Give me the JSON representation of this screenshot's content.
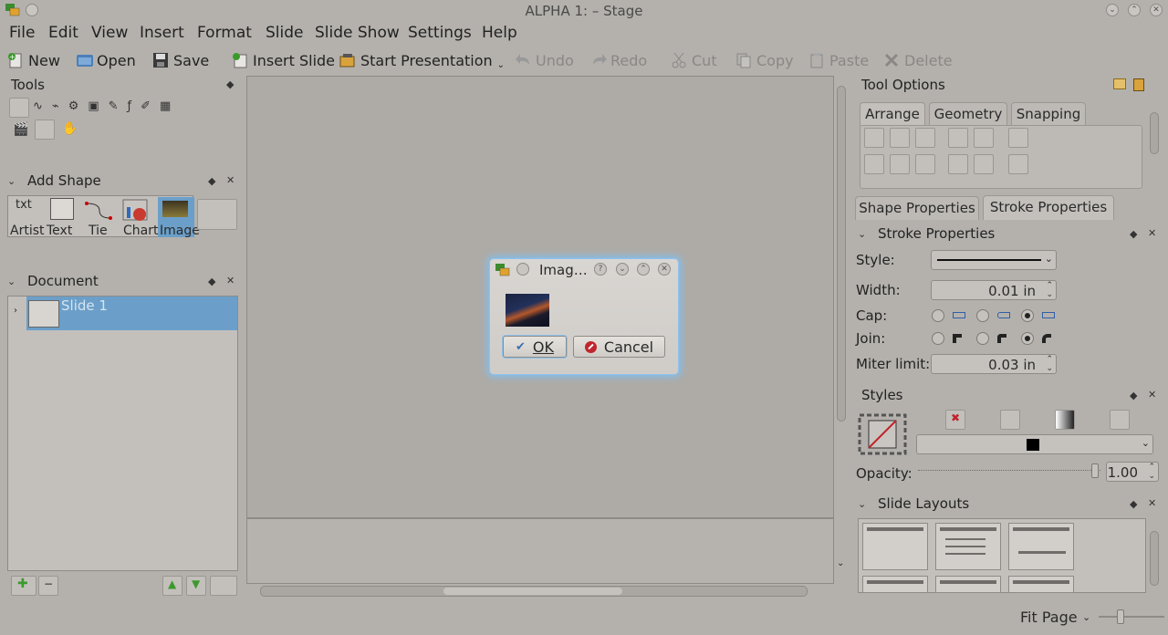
{
  "window": {
    "title": "ALPHA 1:  – Stage"
  },
  "menubar": {
    "items": [
      "File",
      "Edit",
      "View",
      "Insert",
      "Format",
      "Slide",
      "Slide Show",
      "Settings",
      "Help"
    ]
  },
  "toolbar": {
    "new": "New",
    "open": "Open",
    "save": "Save",
    "insert_slide": "Insert Slide",
    "start_presentation": "Start Presentation",
    "undo": "Undo",
    "redo": "Redo",
    "cut": "Cut",
    "copy": "Copy",
    "paste": "Paste",
    "delete": "Delete"
  },
  "tools_panel": {
    "title": "Tools"
  },
  "add_shape_panel": {
    "title": "Add Shape",
    "shapes": [
      "Artist",
      "Text",
      "Tie",
      "Chart",
      "Image"
    ]
  },
  "document_panel": {
    "title": "Document",
    "slide_label": "Slide 1"
  },
  "tool_options": {
    "title": "Tool Options",
    "tabs": [
      "Arrange",
      "Geometry",
      "Snapping"
    ]
  },
  "properties_tabs": [
    "Shape Properties",
    "Stroke Properties"
  ],
  "stroke_properties": {
    "title": "Stroke Properties",
    "style_label": "Style:",
    "width_label": "Width:",
    "width_value": "0.01 in",
    "cap_label": "Cap:",
    "join_label": "Join:",
    "miter_label": "Miter limit:",
    "miter_value": "0.03 in"
  },
  "styles_panel": {
    "title": "Styles",
    "opacity_label": "Opacity:",
    "opacity_value": "1.00"
  },
  "slide_layouts_panel": {
    "title": "Slide Layouts"
  },
  "statusbar": {
    "zoom": "Fit Page"
  },
  "dialog": {
    "title": "Imag…",
    "ok": "OK",
    "cancel": "Cancel"
  },
  "colors": {
    "accent": "#7fc0f2",
    "selection": "#6b9fc9",
    "cancel_red": "#c0262c"
  },
  "icons": [
    "new-icon",
    "open-icon",
    "save-icon",
    "insert-slide-icon",
    "presentation-icon",
    "undo-icon",
    "redo-icon",
    "cut-icon",
    "copy-icon",
    "paste-icon",
    "delete-icon"
  ]
}
